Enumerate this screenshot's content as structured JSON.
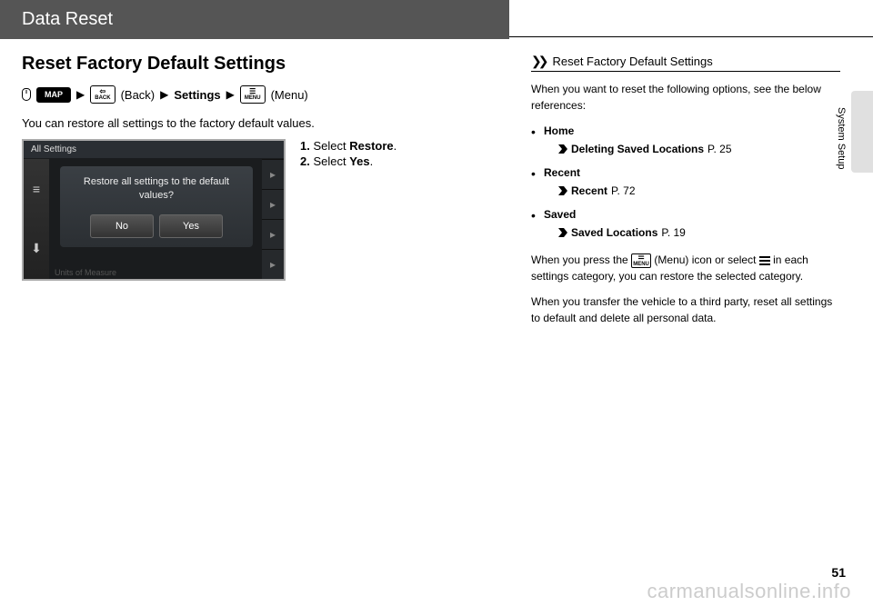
{
  "header": {
    "title": "Data Reset"
  },
  "main": {
    "heading": "Reset Factory Default Settings",
    "breadcrumb": {
      "map": "MAP",
      "back_label": "(Back)",
      "back_icon_top": "⇦",
      "back_icon_bottom": "BACK",
      "settings": "Settings",
      "menu_label": "(Menu)",
      "menu_icon_bottom": "MENU"
    },
    "intro": "You can restore all settings to the factory default values.",
    "screenshot": {
      "header": "All Settings",
      "dialog_line": "Restore all settings to the default values?",
      "btn_no": "No",
      "btn_yes": "Yes",
      "footer": "Units of Measure"
    },
    "steps": [
      {
        "num": "1.",
        "pre": "Select ",
        "bold": "Restore",
        "post": "."
      },
      {
        "num": "2.",
        "pre": "Select ",
        "bold": "Yes",
        "post": "."
      }
    ]
  },
  "sidebar": {
    "note_title": "Reset Factory Default Settings",
    "intro": "When you want to reset the following options, see the below references:",
    "items": [
      {
        "label": "Home",
        "link": "Deleting Saved Locations",
        "page": "P. 25"
      },
      {
        "label": "Recent",
        "link": "Recent",
        "page": "P. 72"
      },
      {
        "label": "Saved",
        "link": "Saved Locations",
        "page": "P. 19"
      }
    ],
    "para2_a": "When you press the ",
    "para2_b": " (Menu) icon or select ",
    "para2_c": " in each settings category, you can restore the selected category.",
    "para3": "When you transfer the vehicle to a third party, reset all settings to default and delete all personal data."
  },
  "side_tab": "System Setup",
  "page_number": "51",
  "watermark": "carmanualsonline.info"
}
